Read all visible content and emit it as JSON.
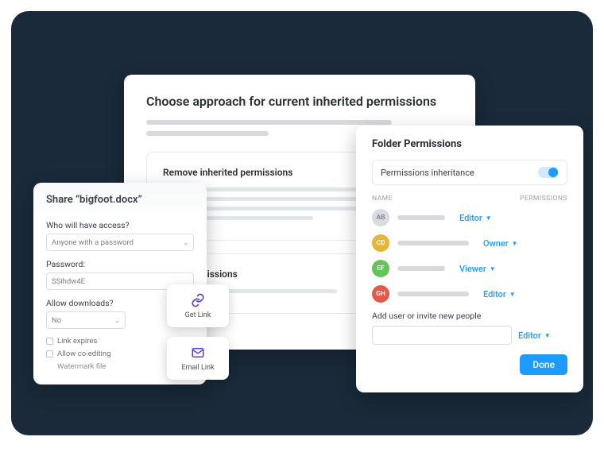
{
  "approach": {
    "title": "Choose approach for current inherited permissions",
    "section_remove": "Remove inherited permissions",
    "section_convert": "rited permissions"
  },
  "share": {
    "title": "Share “bigfoot.docx”",
    "access_label": "Who will have access?",
    "access_value": "Anyone with a password",
    "password_label": "Password:",
    "password_value": "SSihdw4E",
    "downloads_label": "Allow downloads?",
    "downloads_value": "No",
    "checkbox_expires": "Link expires",
    "checkbox_coedit": "Allow co-editing",
    "watermark": "Watermark file"
  },
  "actions": {
    "get_link": "Get Link",
    "email_link": "Email Link"
  },
  "folder": {
    "title": "Folder Permissions",
    "inheritance_label": "Permissions inheritance",
    "inheritance_on": true,
    "col_name": "NAME",
    "col_perm": "PERMISSIONS",
    "rows": [
      {
        "initials": "AB",
        "perm": "Editor"
      },
      {
        "initials": "CD",
        "perm": "Owner"
      },
      {
        "initials": "EF",
        "perm": "Viewer"
      },
      {
        "initials": "GH",
        "perm": "Editor"
      }
    ],
    "add_label": "Add user or invite new people",
    "add_perm_default": "Editor",
    "done": "Done"
  }
}
